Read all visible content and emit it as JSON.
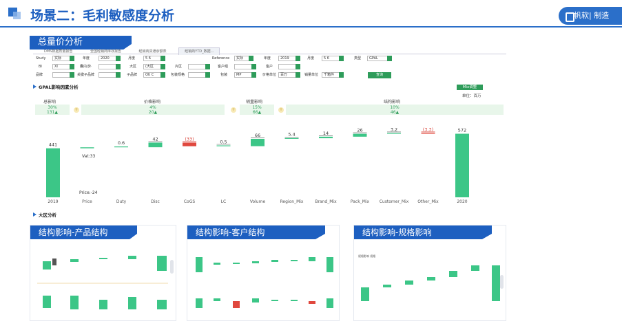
{
  "header": {
    "title": "场景二：毛利敏感度分析",
    "brand": "帆软| 制造"
  },
  "main": {
    "panel_title": "总量价分析",
    "tabs": [
      "DMS数据质量报告",
      "全国经销商库存报告",
      "经销商贸通余额表",
      "经销商YTD_数据..."
    ],
    "filters": {
      "row1": [
        {
          "label": "Study",
          "value": "实际"
        },
        {
          "label": "年度",
          "value": "2020"
        },
        {
          "label": "月度",
          "value": "5  6"
        },
        {
          "label": "Reference",
          "value": "实际"
        },
        {
          "label": "年度",
          "value": "2019"
        },
        {
          "label": "月度",
          "value": "5  6"
        },
        {
          "label": "类型",
          "value": "GPAL"
        }
      ],
      "row2": [
        {
          "label": "BI",
          "value": "XI"
        },
        {
          "label": "囊内/外",
          "value": ""
        },
        {
          "label": "大区",
          "value": "(大区"
        },
        {
          "label": "片区",
          "value": ""
        },
        {
          "label": "客户组",
          "value": ""
        },
        {
          "label": "客户",
          "value": ""
        }
      ],
      "row3": [
        {
          "label": "品牌",
          "value": ""
        },
        {
          "label": "关键子品牌",
          "value": ""
        },
        {
          "label": "子品牌",
          "value": "Oti C"
        },
        {
          "label": "包装规格",
          "value": ""
        },
        {
          "label": "包装",
          "value": "MP"
        },
        {
          "label": "价格单位",
          "value": "百万"
        },
        {
          "label": "销量单位",
          "value": "千箱件"
        }
      ],
      "query_label": "查询"
    },
    "section1": "GPAL影响因素分析",
    "mix_button": "Mix调整",
    "unit_label": "单位：百万",
    "summary": [
      {
        "label": "总影响",
        "pct": "30%",
        "val": "131▲"
      },
      {
        "label": "价格影响",
        "pct": "4%",
        "val": "20▲"
      },
      {
        "label": "销量影响",
        "pct": "15%",
        "val": "66▲"
      },
      {
        "label": "结构影响",
        "pct": "10%",
        "val": "46▲"
      }
    ],
    "vat_label": "Vat:33",
    "price_label": "Price:-24",
    "section2": "大区分析"
  },
  "chart_data": {
    "type": "bar",
    "title": "",
    "categories": [
      "2019",
      "Price",
      "Duty",
      "Disc",
      "CoGS",
      "LC",
      "Volume",
      "Region_Mix",
      "Brand_Mix",
      "Pack_Mix",
      "Customer_Mix",
      "Other_Mix",
      "2020"
    ],
    "labels": [
      "441",
      "",
      "0.6",
      "42",
      "(33)",
      "0.5",
      "66",
      "5.4",
      "14",
      "26",
      "3.2",
      "(3.3)",
      "572"
    ],
    "values": [
      441,
      9,
      0.6,
      42,
      -33,
      0.5,
      66,
      5.4,
      14,
      26,
      3.2,
      -3.3,
      572
    ],
    "kind": [
      "total",
      "delta",
      "delta",
      "delta",
      "delta",
      "delta",
      "delta",
      "delta",
      "delta",
      "delta",
      "delta",
      "delta",
      "total"
    ],
    "colors": {
      "positive": "#3cc687",
      "negative": "#e0483e",
      "total": "#3cc687"
    }
  },
  "subpanels": [
    {
      "title": "结构影响-产品结构"
    },
    {
      "title": "结构影响-客户结构"
    },
    {
      "title": "结构影响-规格影响",
      "legend": "规格影响  规格"
    }
  ]
}
